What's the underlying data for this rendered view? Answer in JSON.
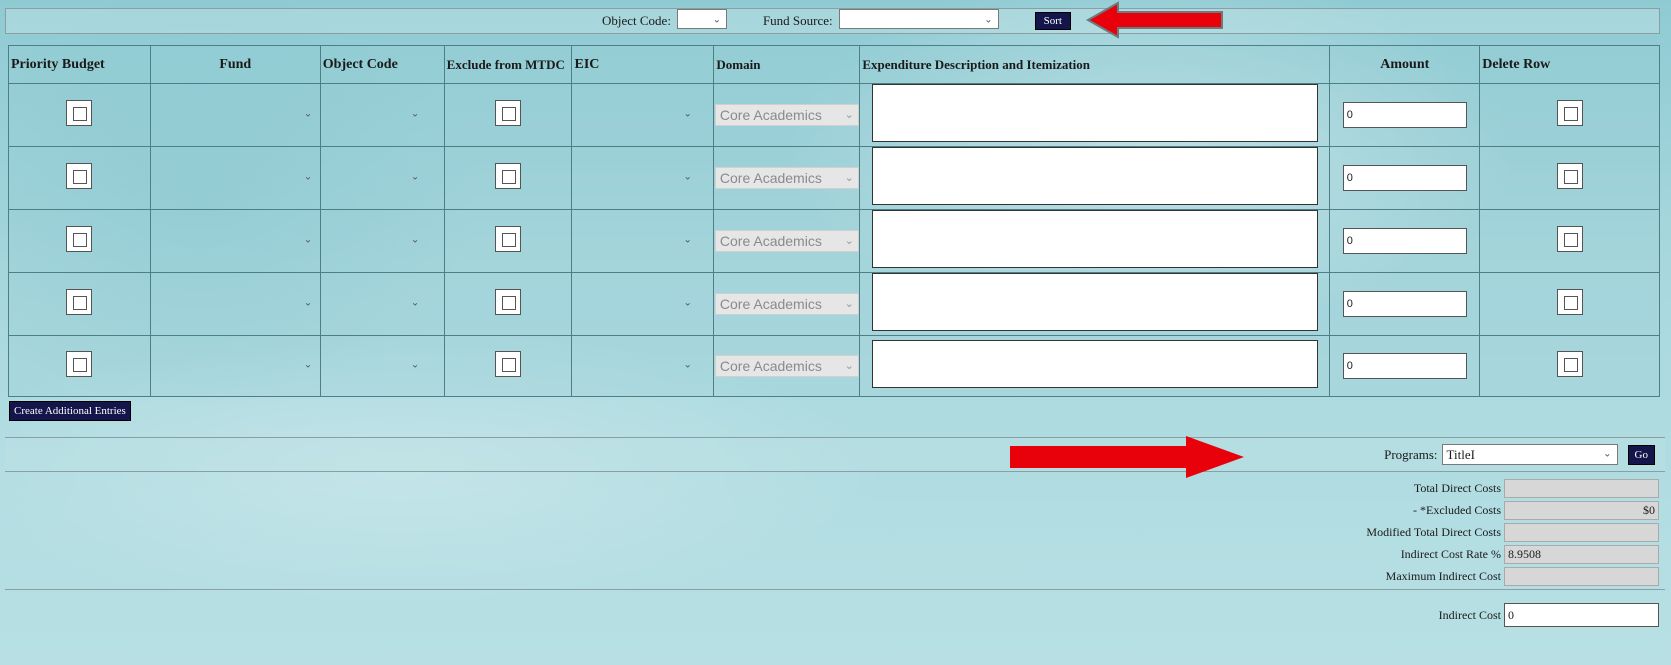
{
  "sort_bar": {
    "object_code_label": "Object Code:",
    "object_code_value": "",
    "fund_source_label": "Fund Source:",
    "fund_source_value": "",
    "sort_label": "Sort"
  },
  "table": {
    "headers": {
      "priority_budget": "Priority Budget",
      "fund": "Fund",
      "object_code": "Object Code",
      "exclude_mtdc": "Exclude from MTDC",
      "eic": "EIC",
      "domain": "Domain",
      "description": "Expenditure Description and Itemization",
      "amount": "Amount",
      "delete_row": "Delete Row"
    },
    "rows": [
      {
        "domain": "Core Academics",
        "amount": "0"
      },
      {
        "domain": "Core Academics",
        "amount": "0"
      },
      {
        "domain": "Core Academics",
        "amount": "0"
      },
      {
        "domain": "Core Academics",
        "amount": "0"
      },
      {
        "domain": "Core Academics",
        "amount": "0"
      }
    ]
  },
  "create_button": "Create Additional Entries",
  "programs": {
    "label": "Programs:",
    "value": "TitleI",
    "go_label": "Go"
  },
  "costs": {
    "total_direct_label": "Total Direct Costs",
    "total_direct_value": "",
    "excluded_label": "- *Excluded Costs",
    "excluded_value": "$0",
    "modified_label": "Modified Total Direct Costs",
    "modified_value": "",
    "rate_label": "Indirect Cost Rate %",
    "rate_value": "8.9508",
    "max_label": "Maximum Indirect Cost",
    "max_value": "",
    "indirect_label": "Indirect Cost",
    "indirect_value": "0"
  },
  "colors": {
    "arrow": "#e8000a",
    "button": "#14154a",
    "background": "#a9d7dd"
  }
}
